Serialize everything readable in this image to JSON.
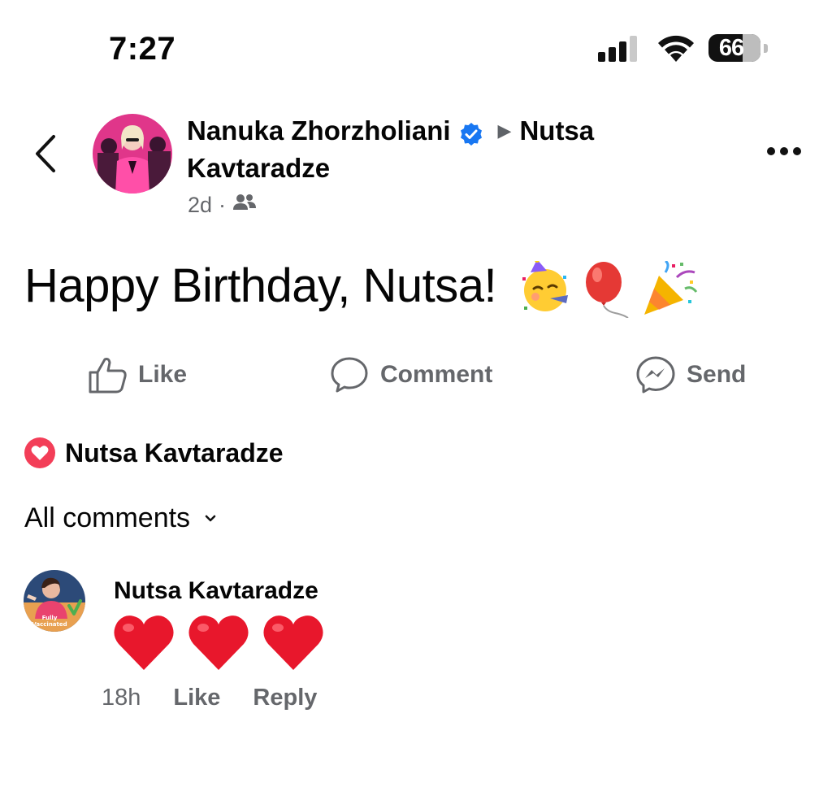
{
  "status_bar": {
    "time": "7:27",
    "battery": "66",
    "icons": [
      "signal-icon",
      "wifi-icon",
      "battery-icon"
    ]
  },
  "header": {
    "author": "Nanuka Zhorzholiani",
    "target": "Nutsa Kavtaradze",
    "time": "2d",
    "separator": "·",
    "audience_icon": "friends-icon",
    "verified_color": "#1877f2"
  },
  "post": {
    "text": "Happy Birthday, Nutsa!",
    "emojis": [
      "partying-face",
      "balloon",
      "party-popper"
    ]
  },
  "actions": {
    "like": "Like",
    "comment": "Comment",
    "send": "Send"
  },
  "reactions": {
    "icon": "love-reaction-icon",
    "name": "Nutsa Kavtaradze",
    "color": "#f33e58"
  },
  "comments_filter": {
    "label": "All comments"
  },
  "comments": [
    {
      "author": "Nutsa Kavtaradze",
      "content_emojis": [
        "red-heart",
        "red-heart",
        "red-heart"
      ],
      "badge_text": "Fully Vaccinated",
      "time": "18h",
      "like": "Like",
      "reply": "Reply"
    }
  ]
}
